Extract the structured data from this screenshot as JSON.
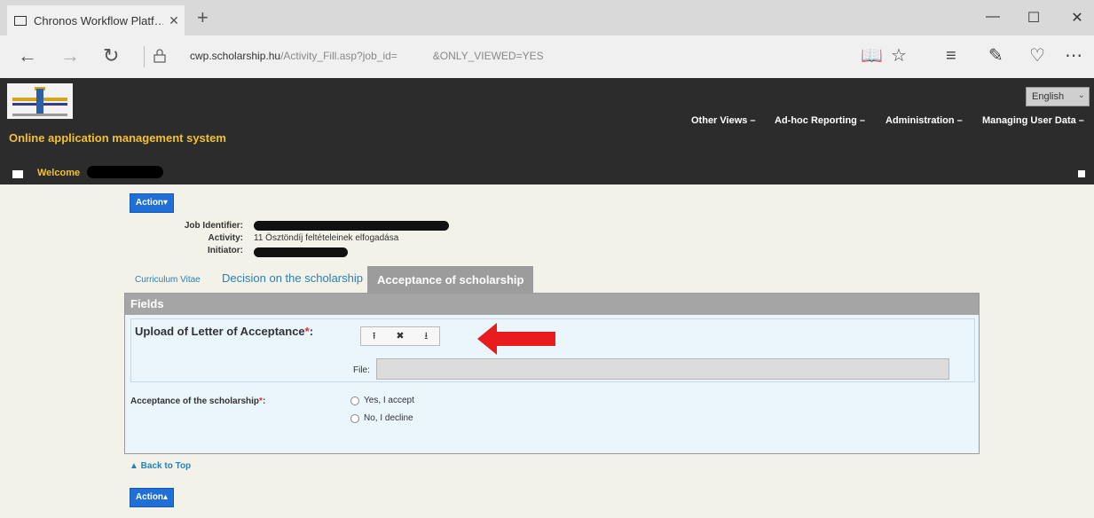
{
  "browser": {
    "tab_title": "Chronos Workflow Platf…",
    "tab_close": "✕",
    "new_tab": "+",
    "url_host": "cwp.scholarship.hu",
    "url_path": "/Activity_Fill.asp?job_id=",
    "url_tail": "&ONLY_VIEWED=YES",
    "win_min": "—",
    "win_max": "☐",
    "win_close": "✕"
  },
  "header": {
    "app_title": "Online application management system",
    "language": "English",
    "menu": [
      "Other Views –",
      "Ad-hoc Reporting –",
      "Administration –",
      "Managing User Data –"
    ],
    "welcome": "Welcome"
  },
  "content": {
    "action_label_top": "Action▾",
    "action_label_bottom": "Action▴",
    "job_identifier_label": "Job Identifier:",
    "activity_label": "Activity:",
    "activity_value": "11 Ösztöndíj feltételeinek elfogadása",
    "initiator_label": "Initiator:",
    "tabs": [
      "Curriculum Vitae",
      "Decision on the scholarship",
      "Acceptance of scholarship"
    ],
    "panel_title": "Fields",
    "upload_label": "Upload of Letter of Acceptance",
    "required_mark": "*",
    "upload_buttons": [
      "⭱",
      "✖",
      "⭳"
    ],
    "file_label": "File:",
    "file_value": "",
    "acceptance_label": "Acceptance of the scholarship",
    "radio_options": [
      "Yes, I accept",
      "No, I decline"
    ],
    "back_to_top": "▲ Back to Top"
  },
  "colors": {
    "accent": "#1f6fd6",
    "header_bg": "#2c2c2c",
    "title_yellow": "#f2c12e",
    "arrow_red": "#e81c1c"
  }
}
